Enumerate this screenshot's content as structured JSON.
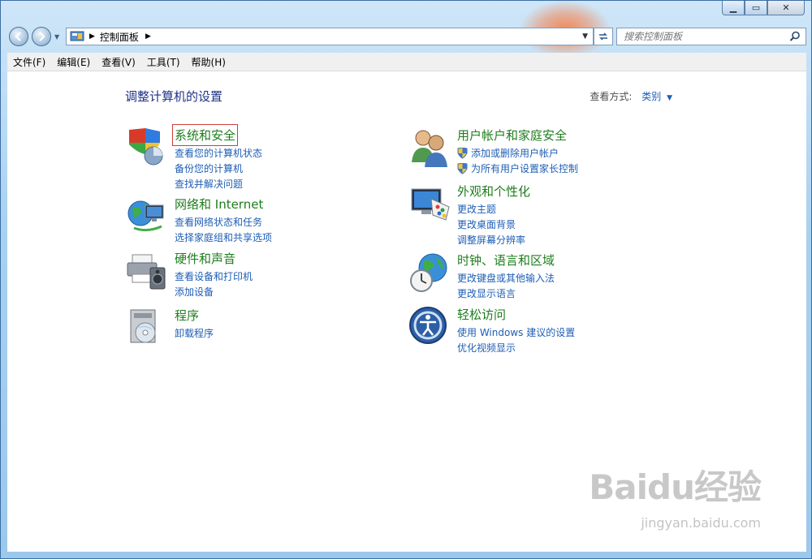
{
  "window": {
    "buttons": {
      "minimize": "▁",
      "maximize": "▭",
      "close": "✕"
    }
  },
  "nav": {
    "back_icon": "back-arrow-icon",
    "forward_icon": "forward-arrow-icon",
    "breadcrumb": "控制面板",
    "search_placeholder": "搜索控制面板"
  },
  "menu": {
    "items": [
      "文件(F)",
      "编辑(E)",
      "查看(V)",
      "工具(T)",
      "帮助(H)"
    ]
  },
  "main": {
    "heading": "调整计算机的设置",
    "view_by_label": "查看方式:",
    "view_by_value": "类别"
  },
  "categories": [
    {
      "title": "系统和安全",
      "icon": "shield-pie-icon",
      "links": [
        "查看您的计算机状态",
        "备份您的计算机",
        "查找并解决问题"
      ]
    },
    {
      "title": "网络和 Internet",
      "icon": "network-globe-icon",
      "links": [
        "查看网络状态和任务",
        "选择家庭组和共享选项"
      ]
    },
    {
      "title": "硬件和声音",
      "icon": "printer-speaker-icon",
      "links": [
        "查看设备和打印机",
        "添加设备"
      ]
    },
    {
      "title": "程序",
      "icon": "programs-cd-icon",
      "links": [
        "卸载程序"
      ]
    },
    {
      "title": "用户帐户和家庭安全",
      "icon": "users-icon",
      "links": [
        "添加或删除用户帐户",
        "为所有用户设置家长控制"
      ]
    },
    {
      "title": "外观和个性化",
      "icon": "monitor-palette-icon",
      "links": [
        "更改主题",
        "更改桌面背景",
        "调整屏幕分辨率"
      ]
    },
    {
      "title": "时钟、语言和区域",
      "icon": "clock-globe-icon",
      "links": [
        "更改键盘或其他输入法",
        "更改显示语言"
      ]
    },
    {
      "title": "轻松访问",
      "icon": "ease-of-access-icon",
      "links": [
        "使用 Windows 建议的设置",
        "优化视频显示"
      ]
    }
  ],
  "watermark": {
    "brand": "Baidu经验",
    "url": "jingyan.baidu.com"
  },
  "colors": {
    "title_green": "#1e7d1e",
    "link_blue": "#1e5eb5",
    "heading_blue": "#1e3287"
  }
}
